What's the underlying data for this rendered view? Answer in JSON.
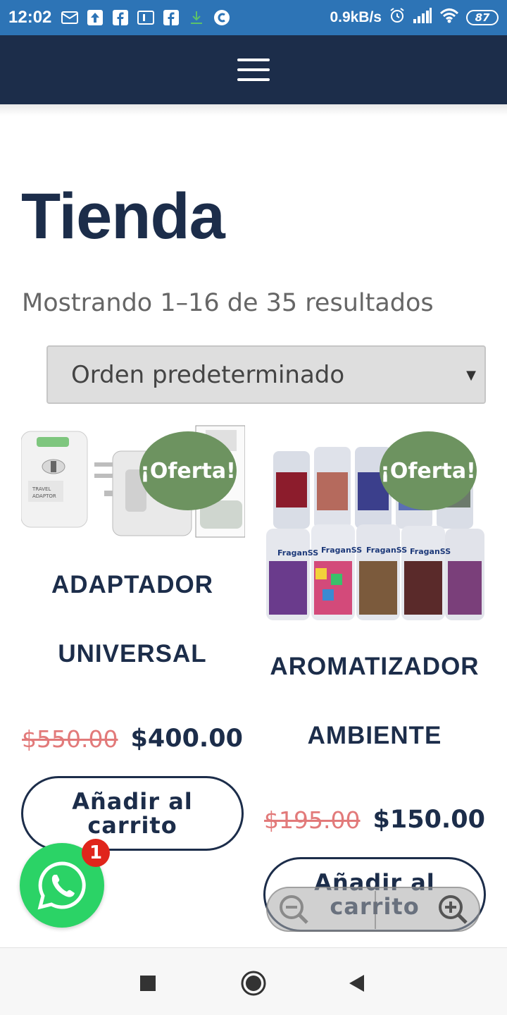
{
  "status_bar": {
    "time": "12:02",
    "net_speed": "0.9kB/s",
    "battery": "87",
    "icons": [
      "mail-icon",
      "upload-icon",
      "facebook-icon",
      "box-icon",
      "facebook-icon",
      "download-icon",
      "c-icon",
      "alarm-icon",
      "signal-icon",
      "wifi-icon",
      "battery-icon"
    ]
  },
  "header": {
    "menu_icon": "hamburger-icon",
    "background": "#1c2d4a"
  },
  "page": {
    "title": "Tienda",
    "result_count": "Mostrando 1–16 de 35 resultados",
    "orderby": {
      "selected": "Orden predeterminado"
    }
  },
  "products": [
    {
      "name_line1": "ADAPTADOR",
      "name_line2": "UNIVERSAL",
      "badge": "¡Oferta!",
      "regular_price": "$550.00",
      "sale_price": "$400.00",
      "button_line1": "Añadir al",
      "button_line2": "carrito",
      "image": "universal-adapter-image"
    },
    {
      "name_line1": "AROMATIZADOR",
      "name_line2": "AMBIENTE",
      "badge": "¡Oferta!",
      "regular_price": "$195.00",
      "sale_price": "$150.00",
      "button_line1": "Añadir al",
      "button_line2": "carrito",
      "image": "air-freshener-cans-image"
    }
  ],
  "whatsapp": {
    "badge_count": "1",
    "color": "#2bd366"
  },
  "colors": {
    "accent": "#1c2d4a",
    "sale_badge": "#6d9360",
    "old_price": "#e27a7a",
    "status_bar": "#2d74b6"
  }
}
